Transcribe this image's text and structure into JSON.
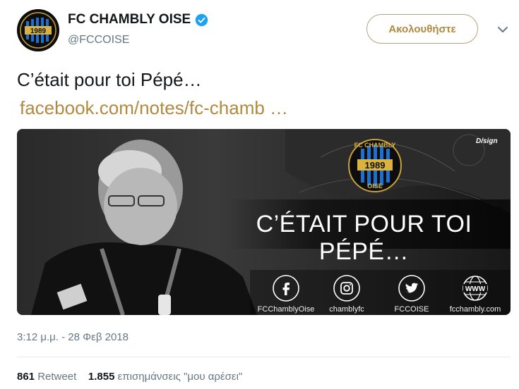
{
  "account": {
    "name": "FC CHAMBLY OISE",
    "handle": "@FCCOISE",
    "logo_top_text": "FC CHAMBLY",
    "logo_year": "1989",
    "logo_bottom_text": "OISE"
  },
  "follow_button": {
    "label": "Ακολουθήστε"
  },
  "tweet": {
    "text": "C’était pour toi Pépé…",
    "link_text": "facebook.com/notes/fc-chamb  …"
  },
  "media": {
    "badge": "D/sign",
    "headline": "C’ÉTAIT POUR TOI PÉPÉ…",
    "social": [
      {
        "icon": "facebook-icon",
        "label": "FCChamblyOise"
      },
      {
        "icon": "instagram-icon",
        "label": "chamblyfc"
      },
      {
        "icon": "twitter-icon",
        "label": "FCCOISE"
      },
      {
        "icon": "www-icon",
        "label": "fcchambly.com"
      }
    ]
  },
  "timestamp": "3:12 μ.μ. - 28 Φεβ 2018",
  "stats": {
    "retweets_count": "861",
    "retweets_label": "Retweet",
    "likes_count": "1.855",
    "likes_label": "επισημάνσεις \"μου αρέσει\""
  },
  "colors": {
    "accent": "#b08a3e",
    "verified": "#1da1f2",
    "muted": "#657786"
  }
}
